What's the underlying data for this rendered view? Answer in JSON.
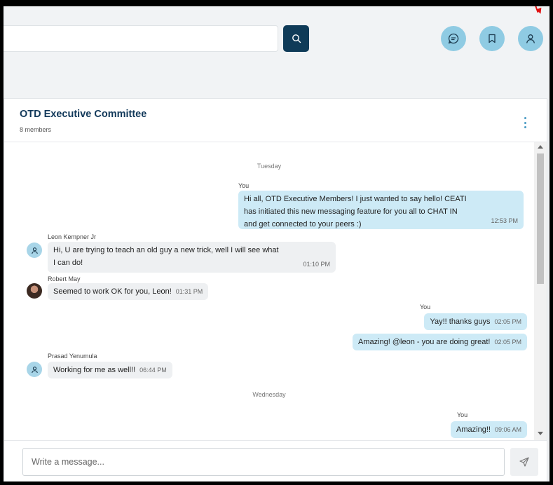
{
  "search": {
    "value": "",
    "placeholder": ""
  },
  "header_icons": [
    "chat-icon",
    "bookmark-icon",
    "user-icon"
  ],
  "group": {
    "title": "OTD Executive Committee",
    "members": "8 members"
  },
  "days": [
    "Tuesday",
    "Wednesday"
  ],
  "messages": [
    {
      "sender": "You",
      "text_line1": "Hi all, OTD Executive Members! I just wanted to say hello! CEATI",
      "text_line2": "has initiated this new messaging feature for you all to CHAT IN",
      "text_line3": "and get connected to your peers :)",
      "time": "12:53 PM"
    },
    {
      "sender": "Leon Kempner Jr",
      "text_line1": "Hi, U are trying to teach an old guy a new trick, well I will see what",
      "text_line2": "I can do!",
      "time": "01:10 PM"
    },
    {
      "sender": "Robert May",
      "text": "Seemed to work OK for you, Leon!",
      "time": "01:31 PM"
    },
    {
      "sender": "You",
      "text": "Yay!! thanks guys",
      "time": "02:05 PM"
    },
    {
      "sender": "",
      "text": "Amazing! @leon - you are doing great!",
      "time": "02:05 PM"
    },
    {
      "sender": "Prasad Yenumula",
      "text": "Working for me as well!!",
      "time": "06:44 PM"
    },
    {
      "sender": "You",
      "text": "Amazing!!",
      "time": "09:06 AM"
    }
  ],
  "composer": {
    "placeholder": "Write a message..."
  },
  "colors": {
    "accent_dark": "#0f3b58",
    "accent_light": "#8fcbe3",
    "my_bubble": "#cdeaf6",
    "their_bubble": "#eef0f2"
  }
}
